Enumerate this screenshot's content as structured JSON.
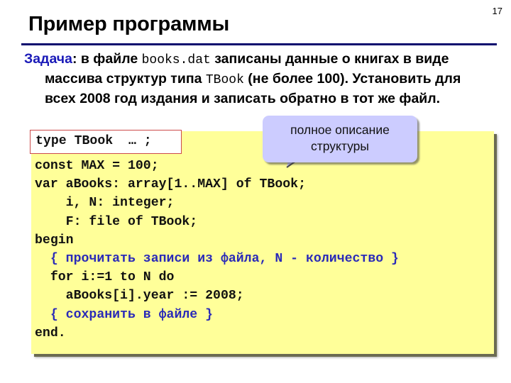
{
  "slide": {
    "number": "17",
    "title": "Пример программы"
  },
  "task": {
    "label": "Задача",
    "colon": ": ",
    "part1": "в файле ",
    "filename": "books.dat",
    "part2": " записаны данные о книгах в виде массива структур типа ",
    "type_name": "TBook",
    "part3": " (не более 100). Установить для всех 2008 год издания и записать обратно в тот же файл."
  },
  "type_box": {
    "text": "type TBook  … ;"
  },
  "callout": {
    "line1": "полное описание",
    "line2": "структуры"
  },
  "code": {
    "lines": [
      {
        "text": "const MAX = 100;",
        "kind": "code"
      },
      {
        "text": "var aBooks: array[1..MAX] of TBook;",
        "kind": "code"
      },
      {
        "text": "    i, N: integer;",
        "kind": "code"
      },
      {
        "text": "    F: file of TBook;",
        "kind": "code"
      },
      {
        "text": "begin",
        "kind": "code"
      },
      {
        "text": "  { прочитать записи из файла, N - количество }",
        "kind": "comment"
      },
      {
        "text": "  for i:=1 to N do",
        "kind": "code"
      },
      {
        "text": "    aBooks[i].year := 2008;",
        "kind": "code"
      },
      {
        "text": "  { сохранить в файле }",
        "kind": "comment"
      },
      {
        "text": "end.",
        "kind": "code"
      }
    ]
  },
  "colors": {
    "title_rule": "#0a0a6e",
    "task_label": "#1a1ab8",
    "code_background": "#ffff99",
    "comment": "#2a2ab8",
    "type_box_border": "#cc4a4a",
    "callout_background": "#ccccff"
  }
}
